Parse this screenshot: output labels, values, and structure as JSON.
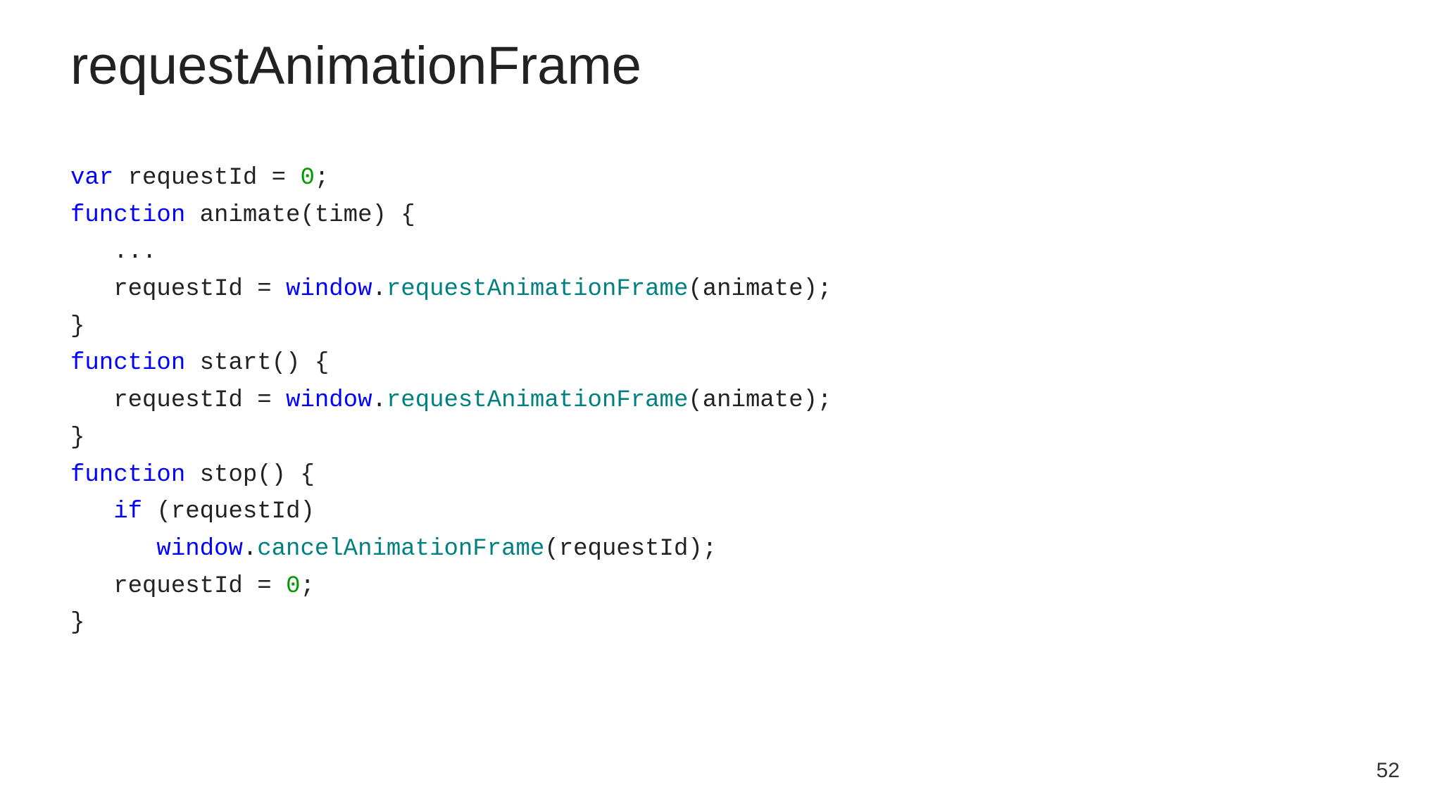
{
  "title": "requestAnimationFrame",
  "page_number": "52",
  "code": {
    "l1": {
      "kw_var": "var",
      "sp1": " requestId = ",
      "num_zero": "0",
      "semi": ";"
    },
    "l2": {
      "kw_fn": "function",
      "sig": " animate(time) {"
    },
    "l3": {
      "body": "   ..."
    },
    "l4": {
      "indent": "   requestId = ",
      "win": "window",
      "dot": ".",
      "raf": "requestAnimationFrame",
      "args": "(animate);"
    },
    "l5": {
      "close": "}"
    },
    "l6": {
      "kw_fn": "function",
      "sig": " start() {"
    },
    "l7": {
      "indent": "   requestId = ",
      "win": "window",
      "dot": ".",
      "raf": "requestAnimationFrame",
      "args": "(animate);"
    },
    "l8": {
      "close": "}"
    },
    "l9": {
      "kw_fn": "function",
      "sig": " stop() {"
    },
    "l10": {
      "indent": "   ",
      "kw_if": "if",
      "rest": " (requestId)"
    },
    "l11": {
      "indent": "      ",
      "win": "window",
      "dot": ".",
      "caf": "cancelAnimationFrame",
      "args": "(requestId);"
    },
    "l12": {
      "indent": "   requestId = ",
      "num_zero": "0",
      "semi": ";"
    },
    "l13": {
      "close": "}"
    }
  }
}
